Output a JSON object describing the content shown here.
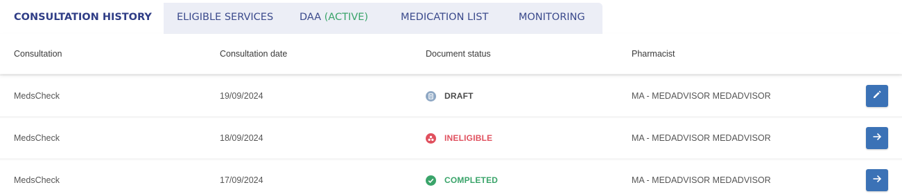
{
  "tabs": [
    {
      "label": "CONSULTATION HISTORY",
      "active": true
    },
    {
      "label": "ELIGIBLE SERVICES",
      "active": false
    },
    {
      "label": "DAA",
      "tag": "(ACTIVE)",
      "active": false
    },
    {
      "label": "MEDICATION LIST",
      "active": false
    },
    {
      "label": "MONITORING",
      "active": false
    }
  ],
  "table": {
    "headers": {
      "consultation": "Consultation",
      "date": "Consultation date",
      "status": "Document status",
      "pharmacist": "Pharmacist"
    },
    "rows": [
      {
        "consultation": "MedsCheck",
        "date": "19/09/2024",
        "status": "DRAFT",
        "status_color": "#4a4a4a",
        "status_icon": "document-icon",
        "pharmacist": "MA - MEDADVISOR MEDADVISOR",
        "action_icon": "pencil-icon"
      },
      {
        "consultation": "MedsCheck",
        "date": "18/09/2024",
        "status": "INELIGIBLE",
        "status_color": "#e0505e",
        "status_icon": "ineligible-icon",
        "pharmacist": "MA - MEDADVISOR MEDADVISOR",
        "action_icon": "arrow-right-icon"
      },
      {
        "consultation": "MedsCheck",
        "date": "17/09/2024",
        "status": "COMPLETED",
        "status_color": "#3aa46a",
        "status_icon": "check-circle-icon",
        "pharmacist": "MA - MEDADVISOR MEDADVISOR",
        "action_icon": "arrow-right-icon"
      }
    ]
  },
  "colors": {
    "accent": "#3b72b6",
    "tab_text": "#3b4a8c",
    "active_green": "#3aa46a",
    "ineligible_red": "#e0505e",
    "draft_icon": "#8fa8c4"
  }
}
